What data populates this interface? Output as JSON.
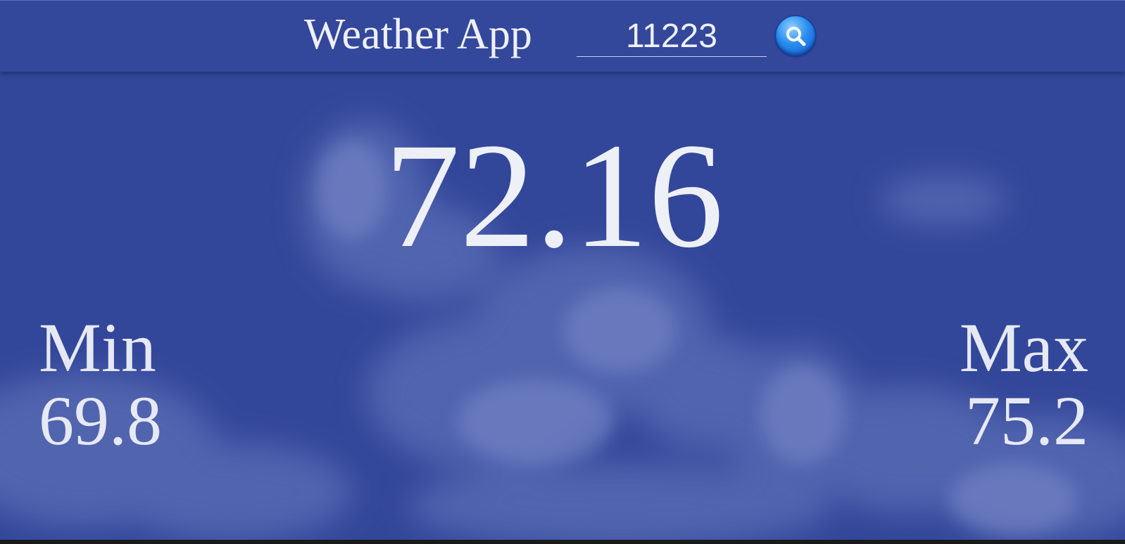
{
  "header": {
    "title": "Weather App",
    "zip_value": "11223",
    "search_icon": "search-icon"
  },
  "weather": {
    "current_temp": "72.16",
    "min_label": "Min",
    "min_value": "69.8",
    "max_label": "Max",
    "max_value": "75.2"
  },
  "colors": {
    "background": "#33479a",
    "topbar": "#33479b",
    "text": "#eef0f8",
    "search_button": "#2a8cf0"
  }
}
